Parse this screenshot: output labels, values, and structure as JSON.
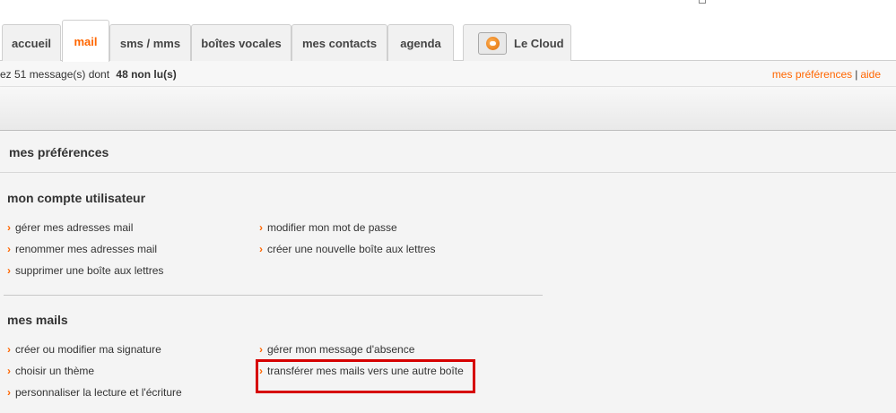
{
  "tabs": [
    {
      "label": "accueil"
    },
    {
      "label": "mail"
    },
    {
      "label": "sms / mms"
    },
    {
      "label": "boîtes vocales"
    },
    {
      "label": "mes contacts"
    },
    {
      "label": "agenda"
    },
    {
      "label": "Le Cloud",
      "icon": "cloud-folder-icon"
    }
  ],
  "status": {
    "text": "ez 51 message(s) dont",
    "unread": "48 non lu(s)",
    "preferences_link": "mes préférences",
    "separator": "|",
    "help_link": "aide"
  },
  "page": {
    "title": "mes préférences"
  },
  "sections": [
    {
      "title": "mon compte utilisateur",
      "links": [
        "gérer mes adresses mail",
        "modifier mon mot de passe",
        "renommer mes adresses mail",
        "créer une nouvelle boîte aux lettres",
        "supprimer une boîte aux lettres"
      ]
    },
    {
      "title": "mes mails",
      "links": [
        "créer ou modifier ma signature",
        "gérer mon message d'absence",
        "choisir un thème",
        "transférer mes mails vers une autre boîte",
        "personnaliser la lecture et l'écriture"
      ]
    }
  ],
  "chevron": "›",
  "colors": {
    "accent": "#ff6600",
    "highlight": "#d60000"
  }
}
